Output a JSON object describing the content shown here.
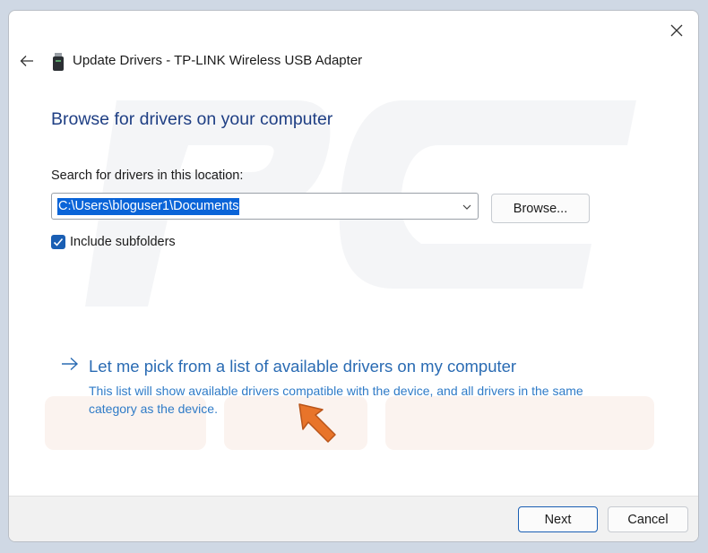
{
  "window": {
    "title": "Update Drivers - TP-LINK Wireless USB Adapter",
    "icons": {
      "close": "close-icon",
      "back": "back-arrow-icon",
      "device": "usb-adapter-icon"
    }
  },
  "main": {
    "heading": "Browse for drivers on your computer",
    "search_label": "Search for drivers in this location:",
    "path_value": "C:\\Users\\bloguser1\\Documents",
    "browse_label": "Browse...",
    "include_subfolders": {
      "label": "Include subfolders",
      "checked": true
    }
  },
  "pick_link": {
    "title": "Let me pick from a list of available drivers on my computer",
    "description": "This list will show available drivers compatible with the device, and all drivers in the same category as the device."
  },
  "footer": {
    "next_label": "Next",
    "cancel_label": "Cancel"
  },
  "colors": {
    "accent": "#1a5fb4",
    "heading": "#1f3f84",
    "link": "#2a6bb3",
    "pointer_arrow": "#e8742a"
  }
}
